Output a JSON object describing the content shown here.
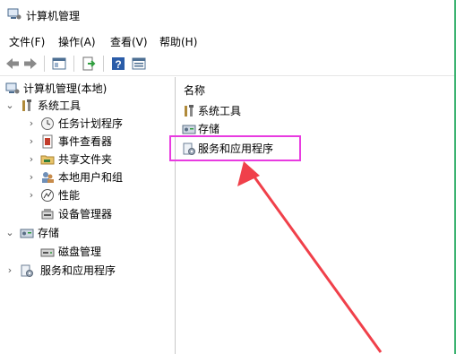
{
  "window": {
    "title": "计算机管理",
    "accent_color": "#3cb371"
  },
  "menu": [
    "文件(F)",
    "操作(A)",
    "查看(V)",
    "帮助(H)"
  ],
  "toolbar": {
    "buttons": [
      "back-arrow-icon",
      "forward-arrow-icon",
      "show-hide-tree-icon",
      "export-list-icon",
      "help-icon",
      "properties-view-icon"
    ]
  },
  "tree": {
    "root": "计算机管理(本地)",
    "system_tools": "系统工具",
    "task_scheduler": "任务计划程序",
    "event_viewer": "事件查看器",
    "shared_folders": "共享文件夹",
    "local_users": "本地用户和组",
    "performance": "性能",
    "device_manager": "设备管理器",
    "storage": "存储",
    "disk_management": "磁盘管理",
    "services_apps": "服务和应用程序"
  },
  "list": {
    "column_header": "名称",
    "items": [
      "系统工具",
      "存储",
      "服务和应用程序"
    ]
  },
  "annotation": {
    "highlight_color": "#e83be0",
    "arrow_color": "#f0404a"
  }
}
